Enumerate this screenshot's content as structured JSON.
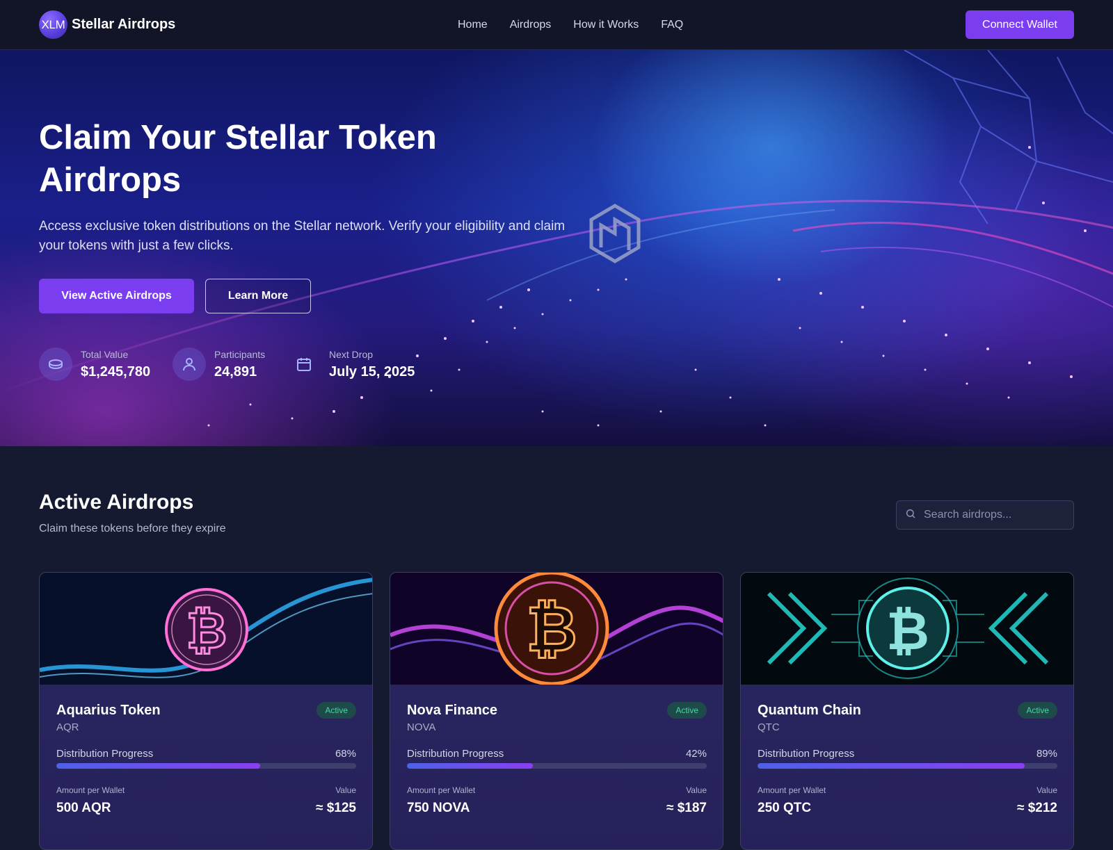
{
  "brand": {
    "mark": "XLM",
    "name": "Stellar Airdrops"
  },
  "nav": {
    "links": [
      "Home",
      "Airdrops",
      "How it Works",
      "FAQ"
    ],
    "connect_label": "Connect Wallet"
  },
  "hero": {
    "title": "Claim Your Stellar Token Airdrops",
    "subtitle": "Access exclusive token distributions on the Stellar network. Verify your eligibility and claim your tokens with just a few clicks.",
    "primary_label": "View Active Airdrops",
    "secondary_label": "Learn More",
    "stats": [
      {
        "label": "Total Value",
        "value": "$1,245,780",
        "icon": "coins-icon"
      },
      {
        "label": "Participants",
        "value": "24,891",
        "icon": "user-icon"
      },
      {
        "label": "Next Drop",
        "value": "July 15, 2025",
        "icon": "calendar-icon"
      }
    ]
  },
  "active": {
    "title": "Active Airdrops",
    "subtitle": "Claim these tokens before they expire",
    "search_placeholder": "Search airdrops...",
    "progress_label": "Distribution Progress",
    "amount_label": "Amount per Wallet",
    "value_label": "Value",
    "cards": [
      {
        "name": "Aquarius Token",
        "symbol": "AQR",
        "status": "Active",
        "progress_text": "68%",
        "progress": 0.68,
        "amount": "500 AQR",
        "value": "≈ $125",
        "accent": "#2fb6ff"
      },
      {
        "name": "Nova Finance",
        "symbol": "NOVA",
        "status": "Active",
        "progress_text": "42%",
        "progress": 0.42,
        "amount": "750 NOVA",
        "value": "≈ $187",
        "accent": "#d04cf5"
      },
      {
        "name": "Quantum Chain",
        "symbol": "QTC",
        "status": "Active",
        "progress_text": "89%",
        "progress": 0.89,
        "amount": "250 QTC",
        "value": "≈ $212",
        "accent": "#27d8d2"
      }
    ]
  },
  "colors": {
    "accent": "#7b3df0",
    "background": "#161a30",
    "nav": "#111527",
    "badge_text": "#4ad6a0"
  }
}
